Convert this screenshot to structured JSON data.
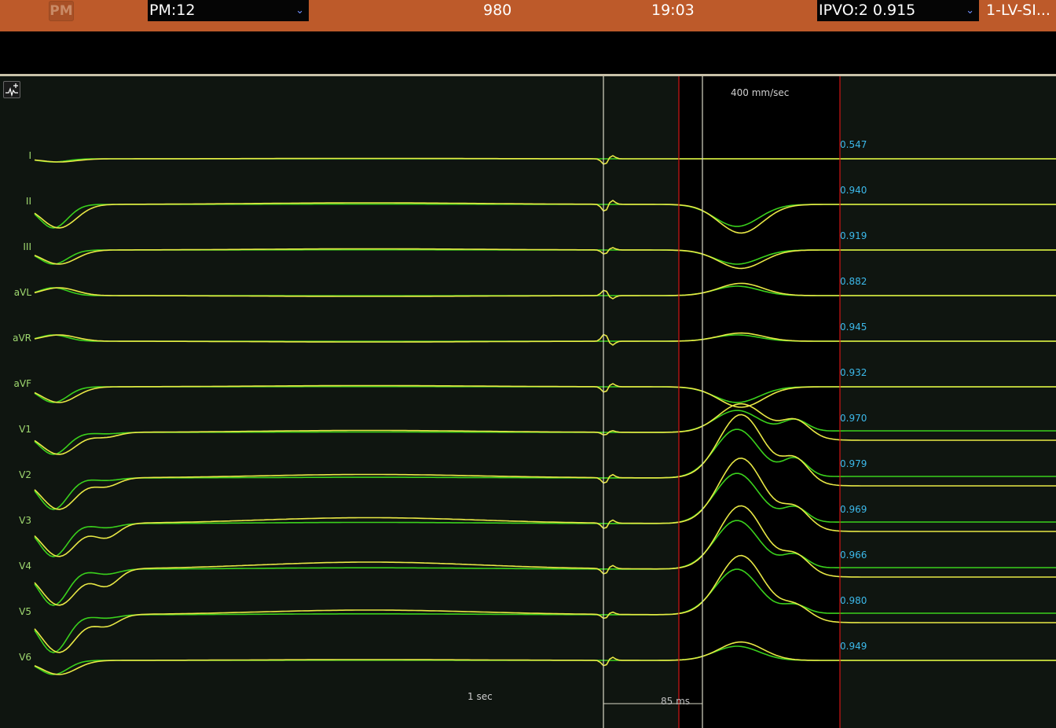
{
  "topbar": {
    "logo_text": "PM",
    "pm_select_value": "PM:12",
    "hr_value": "980",
    "time_value": "19:03",
    "ipvo_select_value": "IPVO:2  0.915",
    "channel_label": "1-LV-SI..."
  },
  "icons": {
    "dropdown": "chevron-down-icon",
    "tool": "waveform-add-icon"
  },
  "panel": {
    "speed_label": "400 mm/sec",
    "time_scale_label": "1 sec",
    "interval_label": "85 ms"
  },
  "leads": [
    {
      "name": "I",
      "score": "0.547"
    },
    {
      "name": "II",
      "score": "0.940"
    },
    {
      "name": "III",
      "score": "0.919"
    },
    {
      "name": "aVL",
      "score": "0.882"
    },
    {
      "name": "aVR",
      "score": "0.945"
    },
    {
      "name": "aVF",
      "score": "0.932"
    },
    {
      "name": "V1",
      "score": "0.970"
    },
    {
      "name": "V2",
      "score": "0.979"
    },
    {
      "name": "V3",
      "score": "0.969"
    },
    {
      "name": "V4",
      "score": "0.966"
    },
    {
      "name": "V5",
      "score": "0.980"
    },
    {
      "name": "V6",
      "score": "0.949"
    }
  ],
  "colors": {
    "topbar": "#bd5a2a",
    "background": "#0f1510",
    "window_band": "#000000",
    "trace_green": "#3ad01c",
    "trace_yellow": "#e8e845",
    "score_text": "#3cb9ea",
    "cursor_red": "#d01515",
    "cursor_white": "#d9d9c6"
  }
}
